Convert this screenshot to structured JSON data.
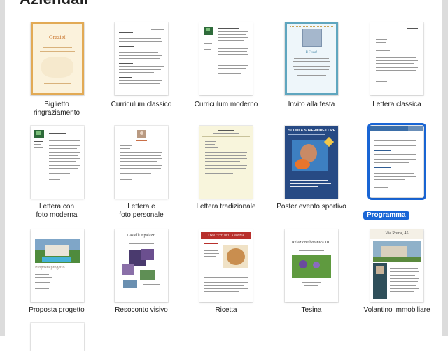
{
  "section": {
    "title": "Aziendali"
  },
  "templates": [
    {
      "id": "biglietto",
      "label": "Biglietto\nringraziamento",
      "thumb_text": "Grazie!"
    },
    {
      "id": "cv-classico",
      "label": "Curriculum classico"
    },
    {
      "id": "cv-moderno",
      "label": "Curriculum moderno"
    },
    {
      "id": "invito",
      "label": "Invito alla festa",
      "thumb_text": "Il Festa!"
    },
    {
      "id": "lettera-classica",
      "label": "Lettera classica"
    },
    {
      "id": "lettera-foto-moderna",
      "label": "Lettera con\nfoto moderna"
    },
    {
      "id": "lettera-foto-personale",
      "label": "Lettera e\nfoto personale"
    },
    {
      "id": "lettera-tradizionale",
      "label": "Lettera tradizionale"
    },
    {
      "id": "poster-sportivo",
      "label": "Poster evento sportivo",
      "thumb_text": "SCUOLA SUPERIORE LOREM"
    },
    {
      "id": "programma",
      "label": "Programma",
      "selected": true
    },
    {
      "id": "proposta",
      "label": "Proposta progetto",
      "thumb_text": "Proposta progetto"
    },
    {
      "id": "resoconto",
      "label": "Resoconto visivo",
      "thumb_text": "Castelli e palazzi"
    },
    {
      "id": "ricetta",
      "label": "Ricetta",
      "thumb_text": "I DOLCETTI DELLA NONNA"
    },
    {
      "id": "tesina",
      "label": "Tesina",
      "thumb_text": "Relazione botanica 101"
    },
    {
      "id": "volantino",
      "label": "Volantino immobiliare",
      "thumb_text": "Via Roma, 45"
    }
  ]
}
